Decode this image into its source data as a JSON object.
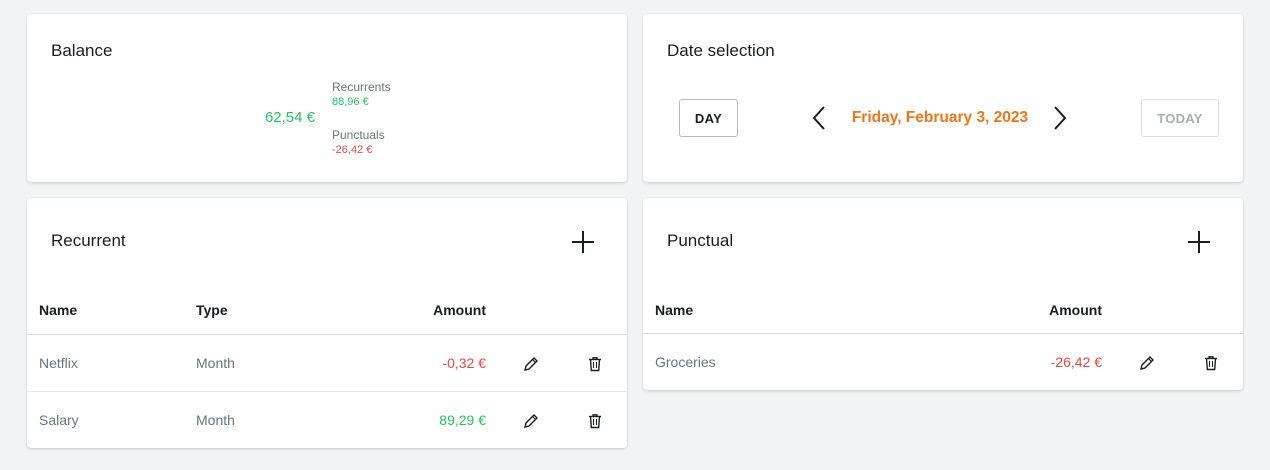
{
  "balance": {
    "title": "Balance",
    "total": "62,54 €",
    "recurrents_label": "Recurrents",
    "recurrents_value": "88,96 €",
    "punctuals_label": "Punctuals",
    "punctuals_value": "-26,42 €"
  },
  "date_selection": {
    "title": "Date selection",
    "mode_button": "DAY",
    "current_date": "Friday, February 3, 2023",
    "today_button": "TODAY",
    "prev_icon": "chevron-left-icon",
    "next_icon": "chevron-right-icon"
  },
  "recurrent": {
    "title": "Recurrent",
    "add_icon": "plus-icon",
    "headers": {
      "name": "Name",
      "type": "Type",
      "amount": "Amount"
    },
    "rows": [
      {
        "name": "Netflix",
        "type": "Month",
        "amount": "-0,32 €"
      },
      {
        "name": "Salary",
        "type": "Month",
        "amount": "89,29 €"
      }
    ]
  },
  "punctual": {
    "title": "Punctual",
    "add_icon": "plus-icon",
    "headers": {
      "name": "Name",
      "amount": "Amount"
    },
    "rows": [
      {
        "name": "Groceries",
        "amount": "-26,42 €"
      }
    ]
  },
  "colors": {
    "positive": "#22c55e",
    "negative": "#ef4444",
    "accent": "#f97316"
  }
}
